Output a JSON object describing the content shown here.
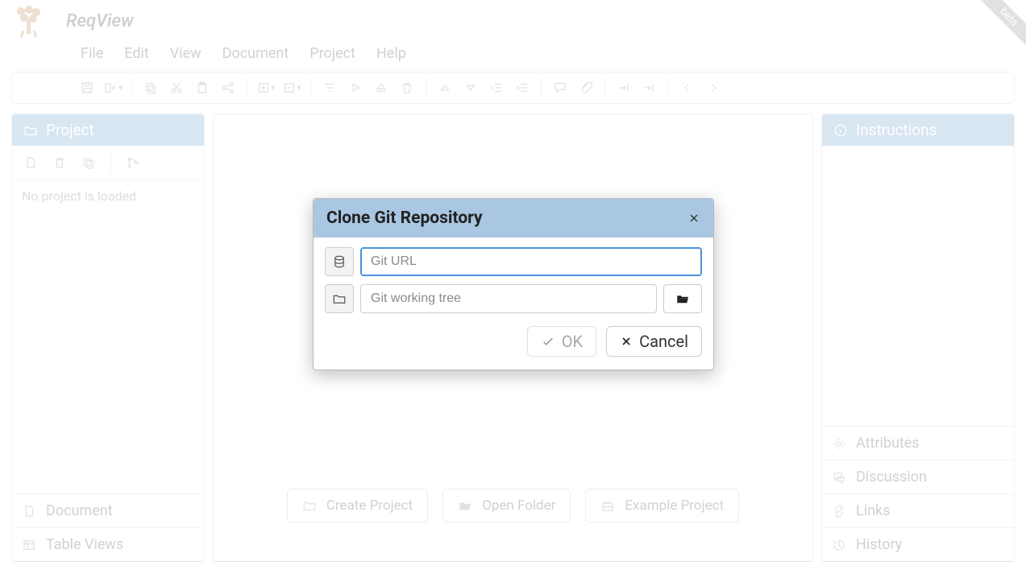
{
  "app": {
    "title": "ReqView",
    "beta": "beta"
  },
  "menu": {
    "file": "File",
    "edit": "Edit",
    "view": "View",
    "document": "Document",
    "project": "Project",
    "help": "Help"
  },
  "left": {
    "header": "Project",
    "empty": "No project is loaded.",
    "tabs": {
      "document": "Document",
      "table_views": "Table Views"
    }
  },
  "center": {
    "buttons": {
      "create": "Create Project",
      "open": "Open Folder",
      "example": "Example Project"
    }
  },
  "right": {
    "header": "Instructions",
    "tabs": {
      "attributes": "Attributes",
      "discussion": "Discussion",
      "links": "Links",
      "history": "History"
    }
  },
  "dialog": {
    "title": "Clone Git Repository",
    "url_placeholder": "Git URL",
    "tree_placeholder": "Git working tree",
    "ok": "OK",
    "cancel": "Cancel"
  }
}
